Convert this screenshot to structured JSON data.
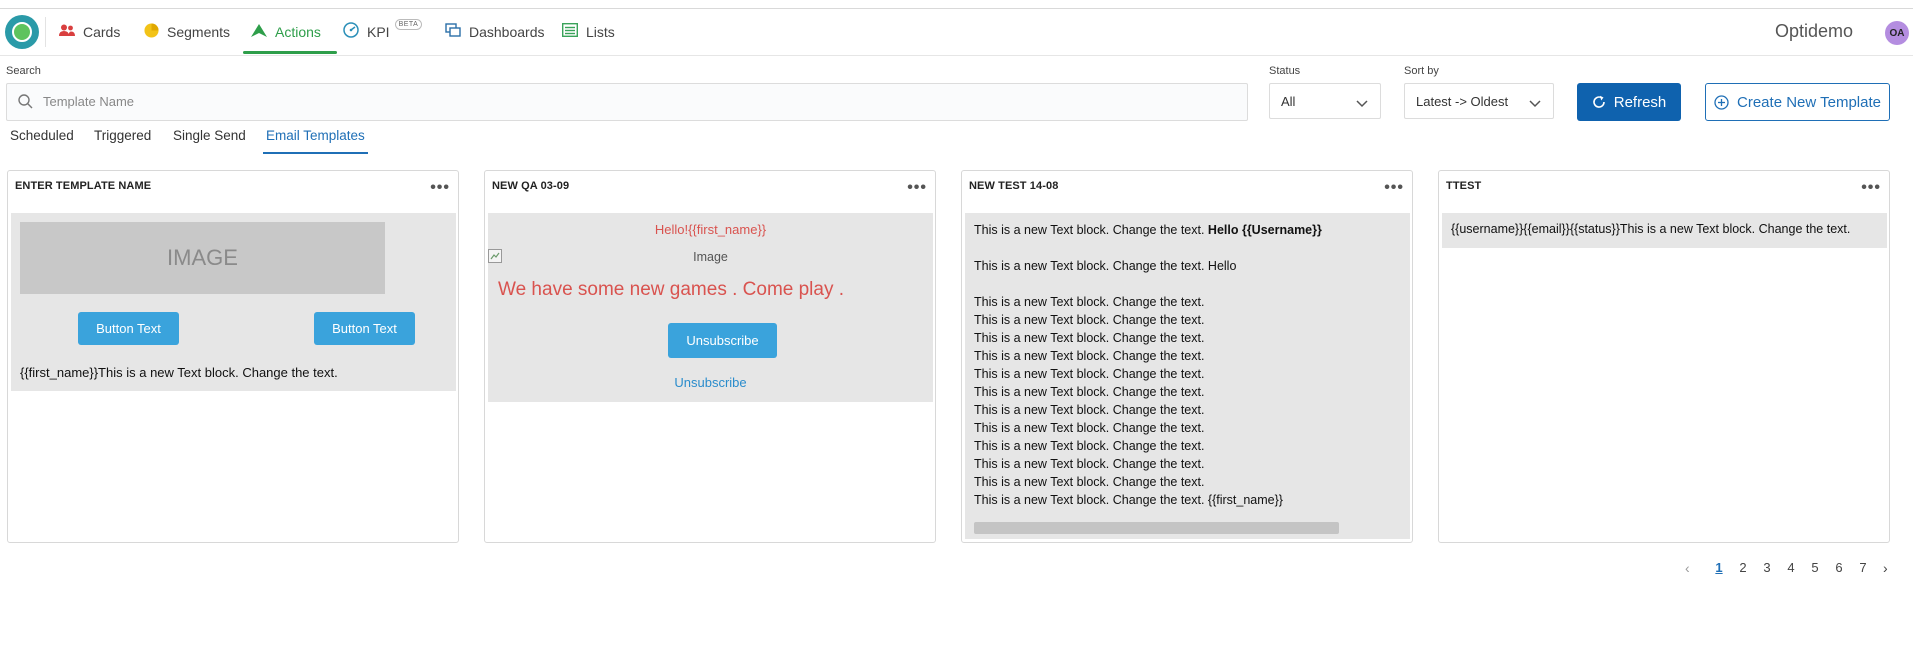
{
  "nav": {
    "items": [
      {
        "label": "Cards",
        "icon": "users-icon"
      },
      {
        "label": "Segments",
        "icon": "pie-chart-icon"
      },
      {
        "label": "Actions",
        "icon": "paper-plane-icon"
      },
      {
        "label": "KPI",
        "icon": "gauge-icon",
        "badge": "BETA"
      },
      {
        "label": "Dashboards",
        "icon": "dashboard-icon"
      },
      {
        "label": "Lists",
        "icon": "list-icon"
      }
    ],
    "active": "Actions",
    "brand": "Optidemo",
    "avatar": "OA",
    "active_color": "#2e9e4a"
  },
  "filters": {
    "search_label": "Search",
    "search_placeholder": "Template Name",
    "status_label": "Status",
    "status_value": "All",
    "sort_label": "Sort by",
    "sort_value": "Latest -> Oldest",
    "refresh_label": "Refresh",
    "create_label": "Create New Template"
  },
  "tabs": [
    "Scheduled",
    "Triggered",
    "Single Send",
    "Email Templates"
  ],
  "active_tab": "Email Templates",
  "cards": [
    {
      "title": "ENTER TEMPLATE NAME",
      "image_placeholder": "IMAGE",
      "button1": "Button Text",
      "button2": "Button Text",
      "text": "{{first_name}}This is a new Text block. Change the text."
    },
    {
      "title": "NEW QA 03-09",
      "greeting": "Hello!{{first_name}}",
      "image_alt": "Image",
      "headline": "We have some new games . Come play .",
      "unsubscribe_button": "Unsubscribe",
      "unsubscribe_link": "Unsubscribe"
    },
    {
      "title": "NEW TEST 14-08",
      "line1_prefix": "This is a new Text block. Change the text. ",
      "line1_bold": "Hello {{Username}}",
      "line2": "This is a new Text block. Change the text. Hello",
      "repeat_line": "This is a new Text block. Change the text.",
      "last_line": "This is a new Text block. Change the text. {{first_name}}"
    },
    {
      "title": "TTEST",
      "text": "{{username}}{{email}}{{status}}This is a new Text block. Change the text."
    }
  ],
  "pagination": {
    "pages": [
      "1",
      "2",
      "3",
      "4",
      "5",
      "6",
      "7"
    ],
    "current": "1"
  },
  "colors": {
    "primary_blue": "#0f62ae",
    "email_button": "#3aa3dc",
    "red_text": "#d9534f"
  }
}
